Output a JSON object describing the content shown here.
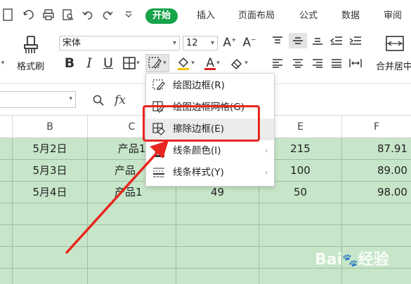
{
  "tabs": [
    {
      "label": "开始",
      "active": true
    },
    {
      "label": "插入"
    },
    {
      "label": "页面布局"
    },
    {
      "label": "公式"
    },
    {
      "label": "数据"
    },
    {
      "label": "审阅"
    }
  ],
  "ribbon": {
    "format_painter_label": "格式刷",
    "font_name": "宋体",
    "font_size": "12",
    "bold": "B",
    "italic": "I",
    "underline": "U",
    "font_color_letter": "A",
    "grow_font": "A⁺",
    "shrink_font": "A⁻",
    "merge_label": "合并居中"
  },
  "formula_bar": {
    "fx": "fx"
  },
  "columns": [
    "B",
    "C",
    "D",
    "E",
    "F"
  ],
  "rows": [
    {
      "b": "5月2日",
      "c": "产品1",
      "d": "",
      "e": "215",
      "f": "87.91"
    },
    {
      "b": "5月3日",
      "c": "产品",
      "d": "",
      "e": "100",
      "f": "89.00"
    },
    {
      "b": "5月4日",
      "c": "产品1",
      "d": "49",
      "e": "50",
      "f": "98.00"
    }
  ],
  "menu": {
    "items": [
      {
        "label": "绘图边框(R)",
        "icon": "draw-border-icon"
      },
      {
        "label": "绘图边框网格(G)",
        "icon": "draw-grid-icon"
      },
      {
        "label": "擦除边框(E)",
        "icon": "eraser-border-icon",
        "highlight": true
      },
      {
        "label": "线条颜色(I)",
        "icon": "line-color-icon",
        "submenu": true
      },
      {
        "label": "线条样式(Y)",
        "icon": "line-style-icon",
        "submenu": true
      }
    ]
  },
  "colors": {
    "accent": "#17a34a",
    "grid_fill": "#c7e6c9",
    "annotation_red": "#e8261f"
  }
}
